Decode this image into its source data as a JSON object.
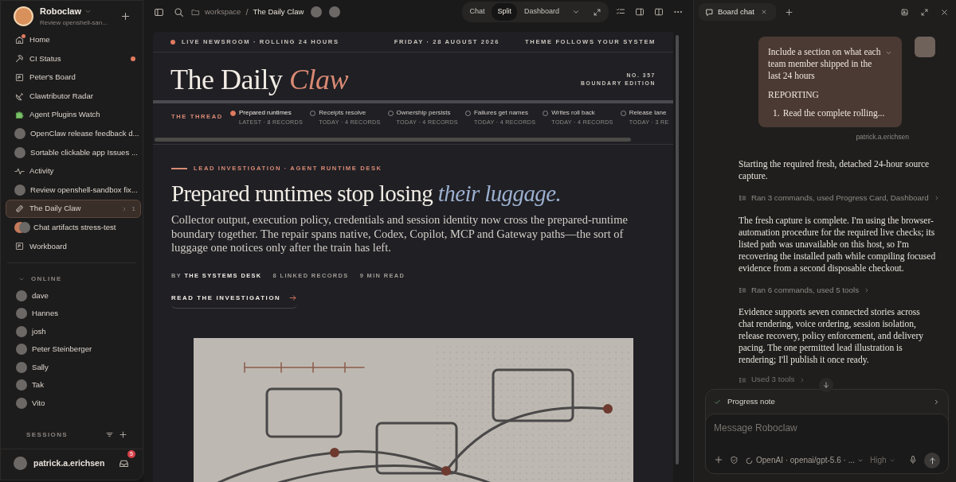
{
  "sidebar": {
    "workspace": {
      "name": "Roboclaw",
      "subtitle": "Review openshell-san..."
    },
    "items": [
      {
        "label": "Home",
        "kind": "home",
        "selected": false,
        "notified": true
      },
      {
        "label": "CI Status",
        "kind": "tool",
        "selected": false,
        "alert": true
      },
      {
        "label": "Peter's Board",
        "kind": "board",
        "selected": false
      },
      {
        "label": "Clawtributor Radar",
        "kind": "dish",
        "selected": false
      },
      {
        "label": "Agent Plugins Watch",
        "kind": "puzzle",
        "selected": false
      },
      {
        "label": "OpenClaw release feedback d...",
        "kind": "avatar",
        "selected": false
      },
      {
        "label": "Sortable clickable app Issues ...",
        "kind": "avatar",
        "selected": false
      },
      {
        "label": "Activity",
        "kind": "activity",
        "selected": false
      },
      {
        "label": "Review openshell-sandbox fix...",
        "kind": "avatar",
        "selected": false
      },
      {
        "label": "The Daily Claw",
        "kind": "paper",
        "selected": true,
        "count": "1"
      },
      {
        "label": "Chat artifacts stress-test",
        "kind": "pair",
        "selected": false
      },
      {
        "label": "Workboard",
        "kind": "board",
        "selected": false
      }
    ],
    "online": {
      "heading": "ONLINE",
      "expanded": true,
      "users": [
        "dave",
        "Hannes",
        "josh",
        "Peter Steinberger",
        "Sally",
        "Tak",
        "Vito"
      ]
    },
    "sessions": {
      "heading": "SESSIONS"
    },
    "user": {
      "name": "patrick.a.erichsen",
      "inbox_count": "5"
    }
  },
  "toolbar": {
    "breadcrumb": [
      "workspace",
      "The Daily Claw"
    ],
    "separator": "/",
    "view_modes": [
      {
        "label": "Chat",
        "selected": false
      },
      {
        "label": "Split",
        "selected": true
      },
      {
        "label": "Dashboard",
        "selected": false
      }
    ]
  },
  "newspaper": {
    "strip": {
      "live": "LIVE NEWSROOM · ROLLING 24 HOURS",
      "date": "FRIDAY · 28 AUGUST 2026",
      "theme": "THEME FOLLOWS YOUR SYSTEM"
    },
    "masthead": "The Daily *Claw*",
    "issue": "NO. 357",
    "edition": "BOUNDARY EDITION",
    "thread": {
      "label": "THE THREAD",
      "items": [
        {
          "title": "Prepared runtimes",
          "meta": "LATEST · 8 RECORDS",
          "selected": true
        },
        {
          "title": "Receipts resolve",
          "meta": "TODAY · 4 RECORDS",
          "selected": false
        },
        {
          "title": "Ownership persists",
          "meta": "TODAY · 4 RECORDS",
          "selected": false
        },
        {
          "title": "Failures get names",
          "meta": "TODAY · 4 RECORDS",
          "selected": false
        },
        {
          "title": "Writes roll back",
          "meta": "TODAY · 4 RECORDS",
          "selected": false
        },
        {
          "title": "Release lane",
          "meta": "TODAY · 3 RE",
          "selected": false
        }
      ]
    },
    "article": {
      "kicker": "LEAD INVESTIGATION · AGENT RUNTIME DESK",
      "headline": "Prepared runtimes stop losing *their luggage.*",
      "dek": "Collector output, execution policy, credentials and session identity now cross the prepared-runtime boundary together. The repair spans native, Codex, Copilot, MCP and Gateway paths—the sort of luggage one notices only after the train has left.",
      "byline": "BY **THE SYSTEMS DESK**",
      "records": "8 LINKED RECORDS",
      "read_time": "9 MIN READ",
      "link": "READ THE INVESTIGATION"
    }
  },
  "chat": {
    "tab": "Board chat",
    "user_message": {
      "lines": "Include a section on what each team member shipped in the last 24 hours",
      "section": "REPORTING",
      "list": [
        {
          "marker": "1.",
          "text": "Read the complete rolling..."
        }
      ],
      "sender": "patrick.a.erichsen"
    },
    "messages": [
      {
        "kind": "text",
        "text": "Starting the required fresh, detached 24-hour source capture."
      },
      {
        "kind": "tools",
        "text": "Ran 3 commands, used Progress Card, Dashboard"
      },
      {
        "kind": "text",
        "text": "The fresh capture is complete. I'm using the browser-automation procedure for the required live checks; its listed path was unavailable on this host, so I'm recovering the installed path while compiling focused evidence from a second disposable checkout."
      },
      {
        "kind": "tools",
        "text": "Ran 6 commands, used 5 tools"
      },
      {
        "kind": "text",
        "text": "Evidence supports seven connected stories across chat rendering, voice ordering, session isolation, release recovery, policy enforcement, and delivery pacing. The one permitted lead illustration is rendering; I'll publish it once ready."
      },
      {
        "kind": "tools",
        "text": "Used 3 tools"
      }
    ],
    "progress": {
      "label": "Progress note",
      "done": true
    },
    "composer": {
      "placeholder": "Message Roboclaw",
      "model": "OpenAI · openai/gpt-5.6 · ...",
      "effort": "High"
    }
  }
}
